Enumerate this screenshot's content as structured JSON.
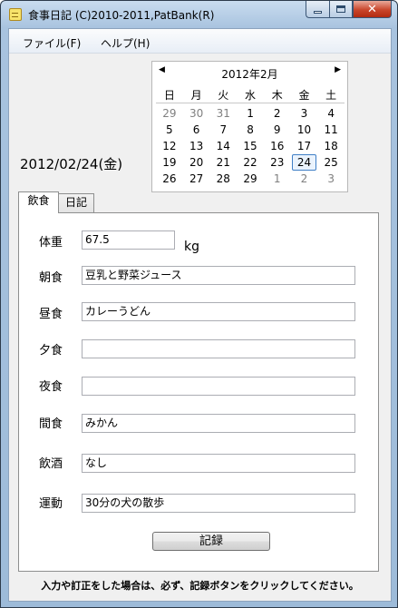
{
  "window": {
    "title": "食事日記 (C)2010-2011,PatBank(R)",
    "minimize": "minimize",
    "maximize": "maximize",
    "close": "✕"
  },
  "menu": [
    "ファイル(F)",
    "ヘルプ(H)"
  ],
  "calendar": {
    "month_label": "2012年2月",
    "prev": "◀",
    "next": "▶",
    "weekdays": [
      "日",
      "月",
      "火",
      "水",
      "木",
      "金",
      "土"
    ],
    "weeks": [
      [
        "29",
        "30",
        "31",
        "1",
        "2",
        "3",
        "4"
      ],
      [
        "5",
        "6",
        "7",
        "8",
        "9",
        "10",
        "11"
      ],
      [
        "12",
        "13",
        "14",
        "15",
        "16",
        "17",
        "18"
      ],
      [
        "19",
        "20",
        "21",
        "22",
        "23",
        "24",
        "25"
      ],
      [
        "26",
        "27",
        "28",
        "29",
        "1",
        "2",
        "3"
      ]
    ],
    "selected": "24"
  },
  "selected_date": "2012/02/24(金)",
  "tabs": [
    "飲食",
    "日記"
  ],
  "active_tab": "飲食",
  "form": {
    "weight_label": "体重",
    "weight_value": "67.5",
    "weight_unit": "kg",
    "breakfast_label": "朝食",
    "breakfast_value": "豆乳と野菜ジュース",
    "lunch_label": "昼食",
    "lunch_value": "カレーうどん",
    "dinner_label": "夕食",
    "dinner_value": "",
    "night_meal_label": "夜食",
    "night_meal_value": "",
    "snack_label": "間食",
    "snack_value": "みかん",
    "drink_label": "飲酒",
    "drink_value": "なし",
    "exercise_label": "運動",
    "exercise_value": "30分の犬の散歩"
  },
  "record_button": "記録",
  "footer_note": "入力や訂正をした場合は、必ず、記録ボタンをクリックしてください。"
}
